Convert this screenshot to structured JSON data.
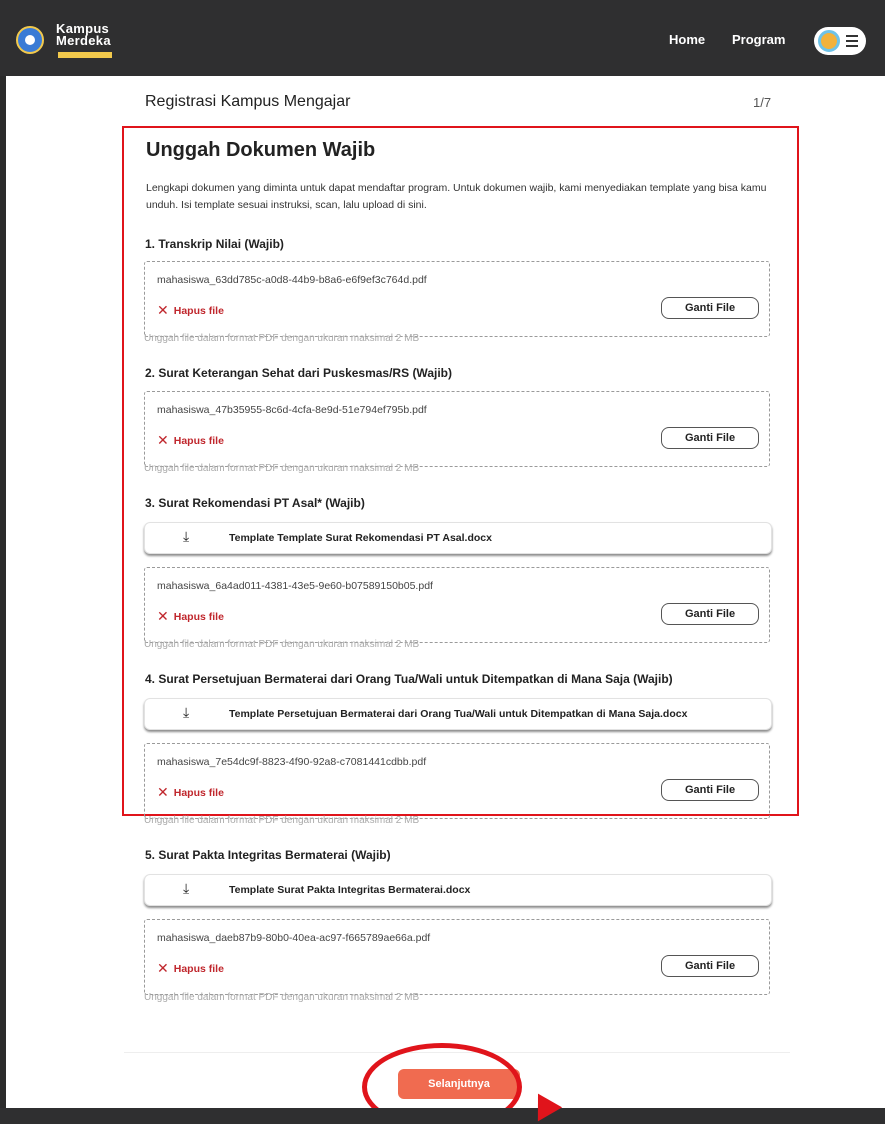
{
  "navbar": {
    "logo_line1": "Kampus",
    "logo_line2": "Merdeka",
    "home": "Home",
    "program": "Program",
    "menu_icon": "hamburger-icon"
  },
  "page": {
    "title": "Registrasi Kampus Mengajar",
    "step": "1/7"
  },
  "section": {
    "title": "Unggah Dokumen Wajib",
    "intro": "Lengkapi dokumen yang diminta untuk dapat mendaftar program. Untuk dokumen wajib, kami menyediakan template yang bisa kamu unduh. Isi template sesuai instruksi, scan, lalu upload di sini."
  },
  "common": {
    "delete_label": "Hapus file",
    "change_label": "Ganti File",
    "hint": "Unggah file dalam format PDF dengan ukuran maksimal 2 MB"
  },
  "documents": [
    {
      "label": "1. Transkrip Nilai (Wajib)",
      "file": "mahasiswa_63dd785c-a0d8-44b9-b8a6-e6f9ef3c764d.pdf"
    },
    {
      "label": "2. Surat Keterangan Sehat dari Puskesmas/RS (Wajib)",
      "file": "mahasiswa_47b35955-8c6d-4cfa-8e9d-51e794ef795b.pdf"
    },
    {
      "label": "3. Surat Rekomendasi PT Asal* (Wajib)",
      "template": "Template Template Surat Rekomendasi PT Asal.docx",
      "file": "mahasiswa_6a4ad011-4381-43e5-9e60-b07589150b05.pdf"
    },
    {
      "label": "4. Surat Persetujuan Bermaterai dari Orang Tua/Wali untuk Ditempatkan di Mana Saja (Wajib)",
      "template": "Template Persetujuan Bermaterai dari Orang Tua/Wali untuk Ditempatkan di Mana Saja.docx",
      "file": "mahasiswa_7e54dc9f-8823-4f90-92a8-c7081441cdbb.pdf"
    },
    {
      "label": "5. Surat Pakta Integritas Bermaterai (Wajib)",
      "template": "Template Surat Pakta Integritas Bermaterai.docx",
      "file": "mahasiswa_daeb87b9-80b0-40ea-ac97-f665789ae66a.pdf"
    }
  ],
  "actions": {
    "next": "Selanjutnya"
  },
  "colors": {
    "annotation": "#e0141b",
    "primary_button": "#f06b50",
    "delete": "#c0272d",
    "navbar": "#2f2f30"
  }
}
